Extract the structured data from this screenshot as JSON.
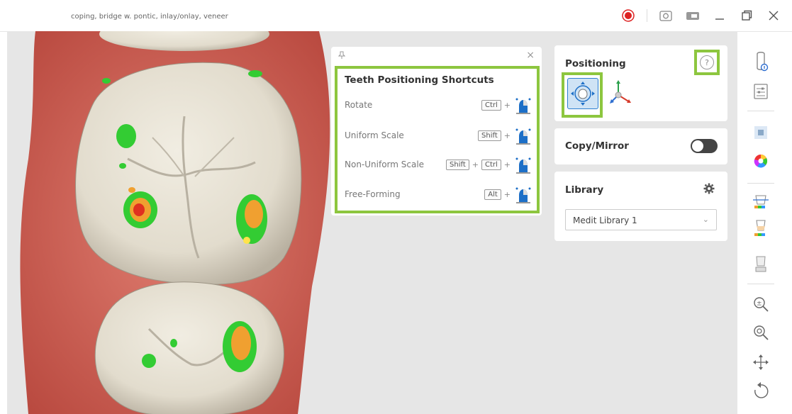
{
  "window": {
    "title": "coping, bridge w. pontic, inlay/onlay, veneer",
    "icons": [
      "record-icon",
      "screenshot-icon",
      "video-icon",
      "minimize-icon",
      "maximize-icon",
      "close-icon"
    ]
  },
  "shortcuts_panel": {
    "pin_icon": "pin-icon",
    "close_label": "×",
    "title": "Teeth Positioning Shortcuts",
    "rows": [
      {
        "label": "Rotate",
        "keys": [
          "Ctrl"
        ]
      },
      {
        "label": "Uniform Scale",
        "keys": [
          "Shift"
        ]
      },
      {
        "label": "Non-Uniform Scale",
        "keys": [
          "Shift",
          "Ctrl"
        ]
      },
      {
        "label": "Free-Forming",
        "keys": [
          "Alt"
        ]
      }
    ],
    "plus": "+"
  },
  "positioning": {
    "title": "Positioning",
    "help_label": "?"
  },
  "copy_mirror": {
    "title": "Copy/Mirror",
    "enabled": false
  },
  "library": {
    "title": "Library",
    "selected": "Medit Library 1",
    "chevron": "⌄"
  },
  "colors": {
    "highlight": "#8dc63f",
    "gum": "#d46a5e",
    "tooth": "#ece7da",
    "contact_green": "#33cc33",
    "contact_orange": "#f0a030",
    "contact_red": "#e03020"
  },
  "toolbar": {
    "icons": [
      "scanner-icon",
      "settings-panel-icon",
      "cube-view-icon",
      "color-wheel-icon",
      "tooth-morph-icon",
      "tooth-shade-icon",
      "crown-icon",
      "zoom-fit-icon",
      "zoom-icon",
      "pan-icon",
      "rotate-icon"
    ]
  }
}
